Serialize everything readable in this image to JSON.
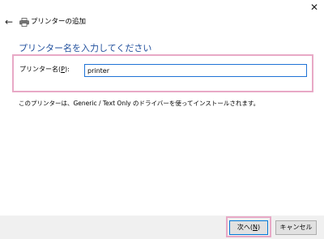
{
  "window": {
    "title": "プリンターの追加",
    "close_glyph": "✕",
    "back_glyph": "←"
  },
  "page": {
    "heading": "プリンター名を入力してください"
  },
  "form": {
    "label_prefix": "プリンター名(",
    "label_accel": "P",
    "label_suffix": "):",
    "value": "printer"
  },
  "note": "このプリンターは、Generic / Text Only のドライバーを使ってインストールされます。",
  "buttons": {
    "next_prefix": "次へ(",
    "next_accel": "N",
    "next_suffix": ")",
    "cancel": "キャンセル"
  },
  "colors": {
    "accent": "#1f4e9c",
    "highlight": "#e8a9c6",
    "focus": "#1f73d6"
  },
  "icons": [
    "close-icon",
    "back-arrow-icon",
    "printer-icon"
  ]
}
